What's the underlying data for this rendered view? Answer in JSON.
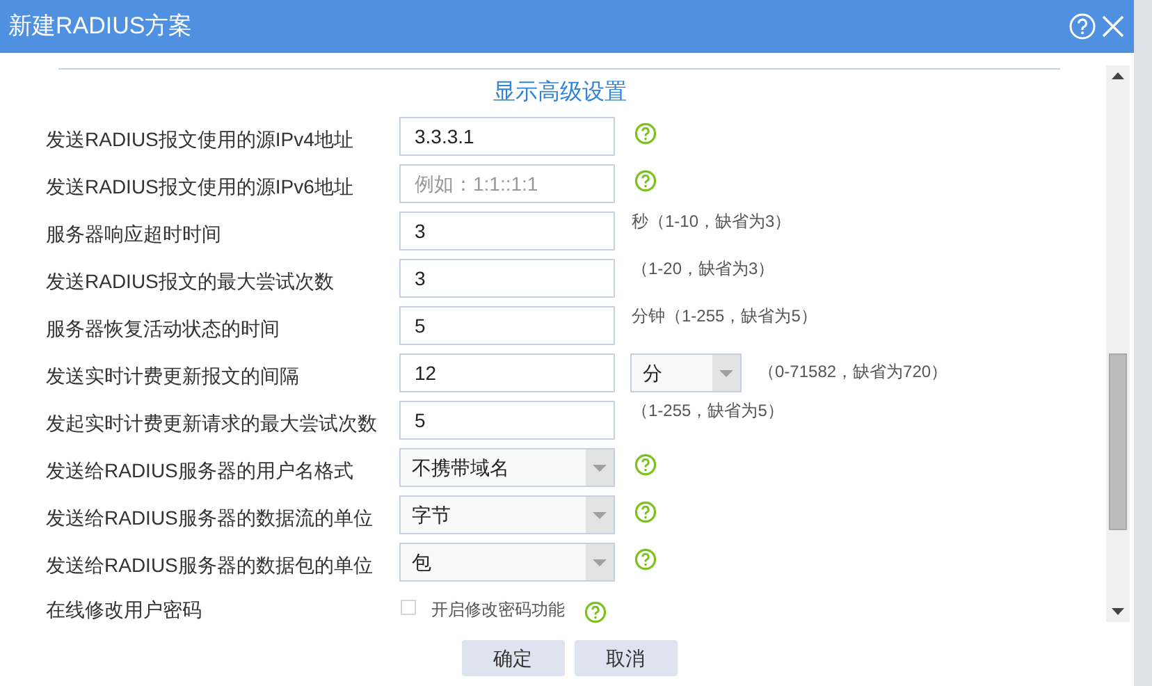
{
  "window": {
    "title": "新建RADIUS方案"
  },
  "advanced_link": "显示高级设置",
  "rows": [
    {
      "label": "发送RADIUS报文使用的源IPv4地址",
      "kind": "text",
      "value": "3.3.3.1",
      "help": true
    },
    {
      "label": "发送RADIUS报文使用的源IPv6地址",
      "kind": "text",
      "placeholder": "例如：1:1::1:1",
      "help": true
    },
    {
      "label": "服务器响应超时时间",
      "kind": "text",
      "value": "3",
      "hint": "秒（1-10，缺省为3）"
    },
    {
      "label": "发送RADIUS报文的最大尝试次数",
      "kind": "text",
      "value": "3",
      "hint": "（1-20，缺省为3）"
    },
    {
      "label": "服务器恢复活动状态的时间",
      "kind": "text",
      "value": "5",
      "hint": "分钟（1-255，缺省为5）"
    },
    {
      "label": "发送实时计费更新报文的间隔",
      "kind": "text",
      "value": "12",
      "unit": "分",
      "hint": "（0-71582，缺省为720）"
    },
    {
      "label": "发起实时计费更新请求的最大尝试次数",
      "kind": "text",
      "value": "5",
      "hint": "（1-255，缺省为5）"
    },
    {
      "label": "发送给RADIUS服务器的用户名格式",
      "kind": "select",
      "value": "不携带域名",
      "help": true
    },
    {
      "label": "发送给RADIUS服务器的数据流的单位",
      "kind": "select",
      "value": "字节",
      "help": true
    },
    {
      "label": "发送给RADIUS服务器的数据包的单位",
      "kind": "select",
      "value": "包",
      "help": true
    },
    {
      "label": "在线修改用户密码",
      "kind": "checkbox",
      "option": "开启修改密码功能",
      "checked": false,
      "help": true
    }
  ],
  "buttons": [
    "确定",
    "取消"
  ]
}
